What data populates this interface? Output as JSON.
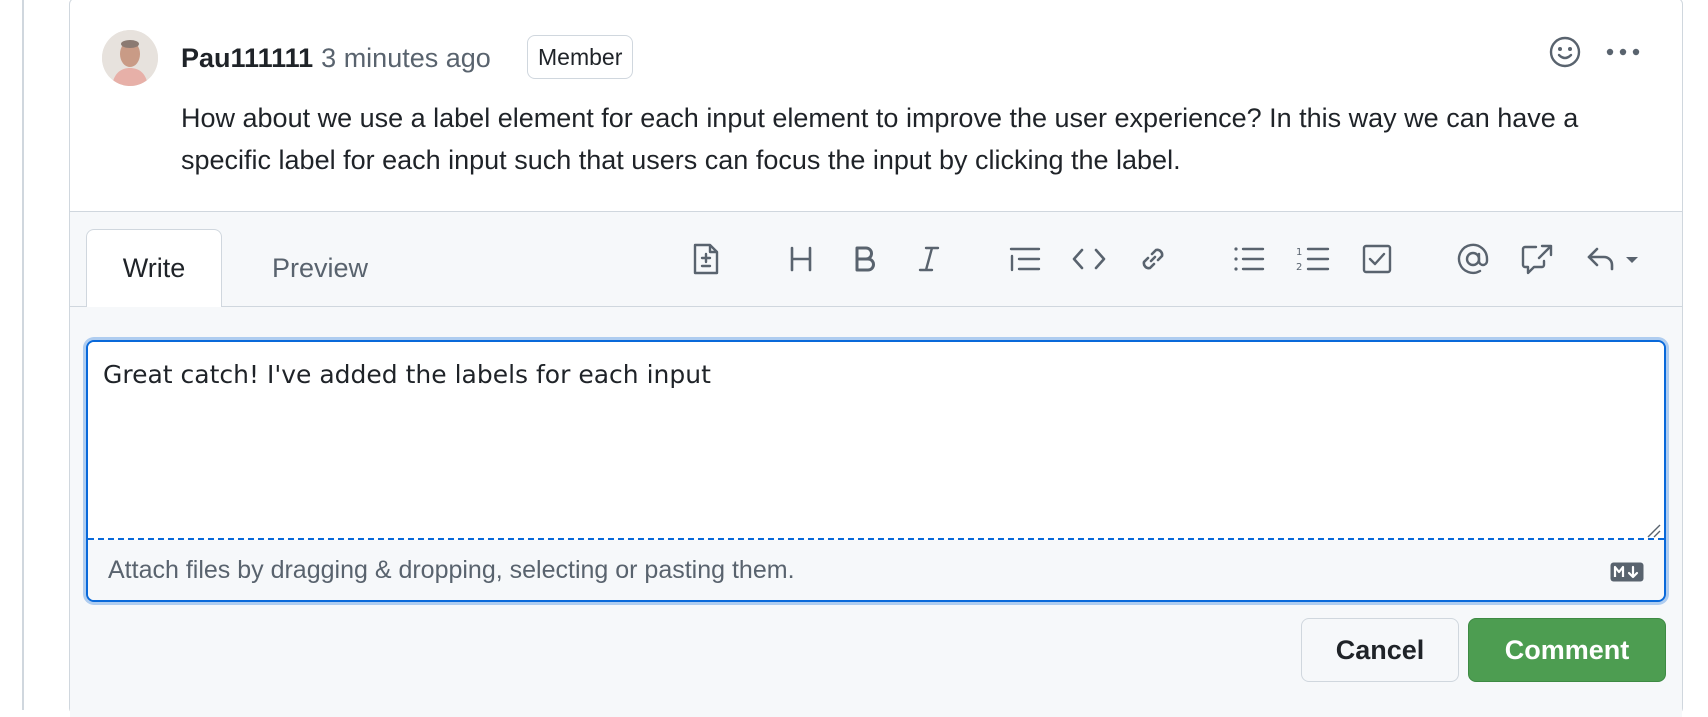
{
  "comment": {
    "author": "Pau111111",
    "timestamp": "3 minutes ago",
    "badge": "Member",
    "body": "How about we use a label element for each input element to improve the user experience? In this way we can have a specific label for each input such that users can focus the input by clicking the label."
  },
  "header_icons": [
    "smiley-icon",
    "kebab-horizontal-icon"
  ],
  "editor": {
    "tabs": [
      {
        "label": "Write",
        "active": true
      },
      {
        "label": "Preview",
        "active": false
      }
    ],
    "toolbar_icons": [
      "diff-file-icon",
      "heading-icon",
      "bold-icon",
      "italic-icon",
      "quote-icon",
      "code-icon",
      "link-icon",
      "unordered-list-icon",
      "ordered-list-icon",
      "tasklist-icon",
      "mention-icon",
      "cross-reference-icon",
      "reply-icon"
    ],
    "value": "Great catch! I've added the labels for each input",
    "attach_hint": "Attach files by dragging & dropping, selecting or pasting them."
  },
  "actions": {
    "cancel": "Cancel",
    "comment": "Comment"
  },
  "colors": {
    "accent": "#0969da",
    "comment_button": "#4d9d51",
    "border": "#d0d7de",
    "muted_text": "#59636e"
  }
}
